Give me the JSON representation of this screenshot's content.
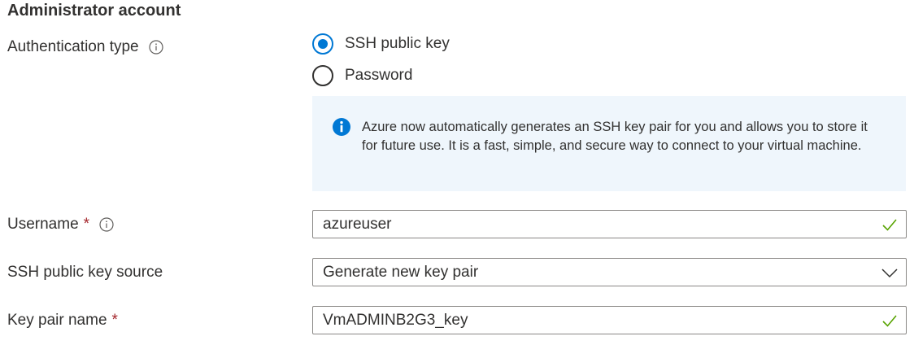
{
  "section": {
    "title": "Administrator account"
  },
  "auth": {
    "label": "Authentication type",
    "options": [
      {
        "label": "SSH public key",
        "checked": true
      },
      {
        "label": "Password",
        "checked": false
      }
    ],
    "info_text": "Azure now automatically generates an SSH key pair for you and allows you to store it for future use. It is a fast, simple, and secure way to connect to your virtual machine."
  },
  "username": {
    "label": "Username",
    "required_mark": "*",
    "value": "azureuser",
    "valid": true
  },
  "key_source": {
    "label": "SSH public key source",
    "selected": "Generate new key pair"
  },
  "key_pair_name": {
    "label": "Key pair name",
    "required_mark": "*",
    "value": "VmADMINB2G3_key",
    "valid": true
  },
  "colors": {
    "accent": "#0078d4",
    "valid": "#57a300",
    "required": "#a4262c",
    "info_bg": "#eff6fc"
  },
  "icons": {
    "info": "info-circle-icon",
    "valid": "checkmark-icon",
    "dropdown": "chevron-down-icon"
  }
}
